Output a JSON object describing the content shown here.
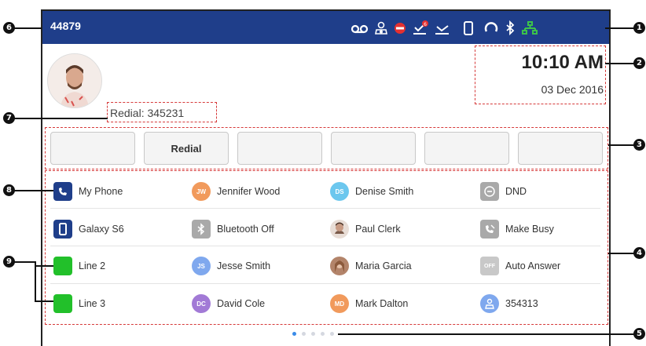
{
  "status_bar": {
    "extension": "44879",
    "icons": [
      "voicemail-icon",
      "contacts-icon",
      "dnd-icon",
      "missed-call-icon",
      "forward-icon",
      "mobile-icon",
      "headset-icon",
      "bluetooth-icon",
      "network-icon"
    ],
    "missed_badge": "6",
    "color": "#1f3e8a"
  },
  "clock": {
    "time": "10:10 AM",
    "date": "03 Dec 2016"
  },
  "redial_line": "Redial: 345231",
  "softkeys": [
    "",
    "Redial",
    "",
    "",
    "",
    ""
  ],
  "line_keys": [
    {
      "label": "My Phone",
      "icon": "phone-icon",
      "color": "#1f3e8a"
    },
    {
      "label": "Galaxy S6",
      "icon": "mobile-icon",
      "color": "#1f3e8a"
    },
    {
      "label": "Line 2",
      "icon": "line-icon",
      "color": "#22c02a"
    },
    {
      "label": "Line 3",
      "icon": "line-icon",
      "color": "#22c02a"
    },
    {
      "label": "Jennifer Wood",
      "initials": "JW",
      "color": "#f19a5c"
    },
    {
      "label": "Bluetooth Off",
      "icon": "bluetooth-icon",
      "color": "#a9a9a9"
    },
    {
      "label": "Jesse Smith",
      "initials": "JS",
      "color": "#7fa8ee"
    },
    {
      "label": "David Cole",
      "initials": "DC",
      "color": "#a27ad6"
    },
    {
      "label": "Denise Smith",
      "initials": "DS",
      "color": "#6cc7ee"
    },
    {
      "label": "Paul Clerk",
      "icon": "photo-avatar-icon",
      "color": "#c89b84"
    },
    {
      "label": "Maria Garcia",
      "icon": "photo-avatar-icon",
      "color": "#c9a58c"
    },
    {
      "label": "Mark Dalton",
      "initials": "MD",
      "color": "#f19a5c"
    },
    {
      "label": "DND",
      "icon": "dnd-icon",
      "color": "#a9a9a9"
    },
    {
      "label": "Make Busy",
      "icon": "make-busy-icon",
      "color": "#a9a9a9"
    },
    {
      "label": "Auto Answer",
      "icon": "auto-answer-icon",
      "color": "#a9a9a9"
    },
    {
      "label": "354313",
      "icon": "contact-icon",
      "color": "#7fa8ee"
    }
  ],
  "pages": {
    "total": 5,
    "active": 1
  },
  "callouts": [
    "6",
    "1",
    "2",
    "7",
    "3",
    "8",
    "4",
    "9",
    "5"
  ]
}
